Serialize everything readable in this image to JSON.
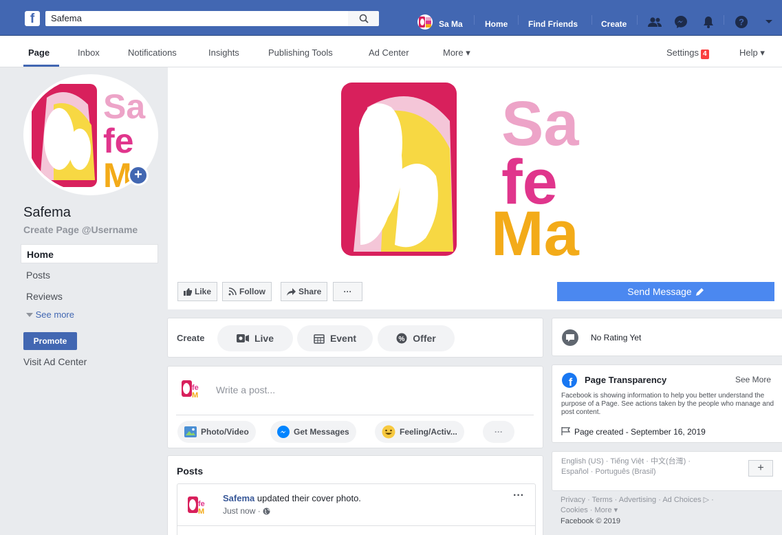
{
  "topbar": {
    "logo": "f",
    "search_value": "Safema",
    "user_name": "Sa Ma",
    "links": [
      "Home",
      "Find Friends",
      "Create"
    ]
  },
  "subnav": {
    "tabs": [
      "Page",
      "Inbox",
      "Notifications",
      "Insights",
      "Publishing Tools",
      "Ad Center",
      "More ▾"
    ],
    "settings_label": "Settings",
    "settings_badge": "4",
    "help_label": "Help ▾"
  },
  "profile": {
    "name": "Safema",
    "username": "Create Page @Username"
  },
  "left_nav": {
    "items": [
      "Home",
      "Posts",
      "Reviews"
    ],
    "see_more": "See more",
    "promote": "Promote",
    "visit_ad_center": "Visit Ad Center"
  },
  "cover": {
    "like": "Like",
    "follow": "Follow",
    "share": "Share",
    "more": "···",
    "send_message": "Send Message",
    "logo_letters": [
      "Sa",
      "fe",
      "Ma"
    ]
  },
  "create_bar": {
    "label": "Create",
    "live": "Live",
    "event": "Event",
    "offer": "Offer"
  },
  "composer": {
    "placeholder": "Write a post...",
    "photo_video": "Photo/Video",
    "get_messages": "Get Messages",
    "feeling": "Feeling/Activ...",
    "more": "···"
  },
  "posts": {
    "header": "Posts",
    "author": "Safema",
    "action": "updated their cover photo.",
    "time": "Just now ·",
    "menu": "···"
  },
  "right": {
    "rating": "No Rating Yet",
    "transparency_title": "Page Transparency",
    "see_more": "See More",
    "transparency_text": "Facebook is showing information to help you better understand the purpose of a Page. See actions taken by the people who manage and post content.",
    "page_created": "Page created - September 16, 2019",
    "languages_line1": "English (US) · Tiếng Việt · 中文(台灣) ·",
    "languages_line2": "Español · Português (Brasil)",
    "add_lang": "+",
    "footer_line1": "Privacy · Terms · Advertising · Ad Choices ▷ ·",
    "footer_line2": "Cookies · More ▾",
    "copyright": "Facebook © 2019"
  },
  "colors": {
    "brand_blue": "#4267b2",
    "logo_pink": "#e0358c",
    "logo_light_pink": "#eda4c8",
    "logo_yellow": "#f3ab19",
    "logo_red": "#d8205c"
  }
}
